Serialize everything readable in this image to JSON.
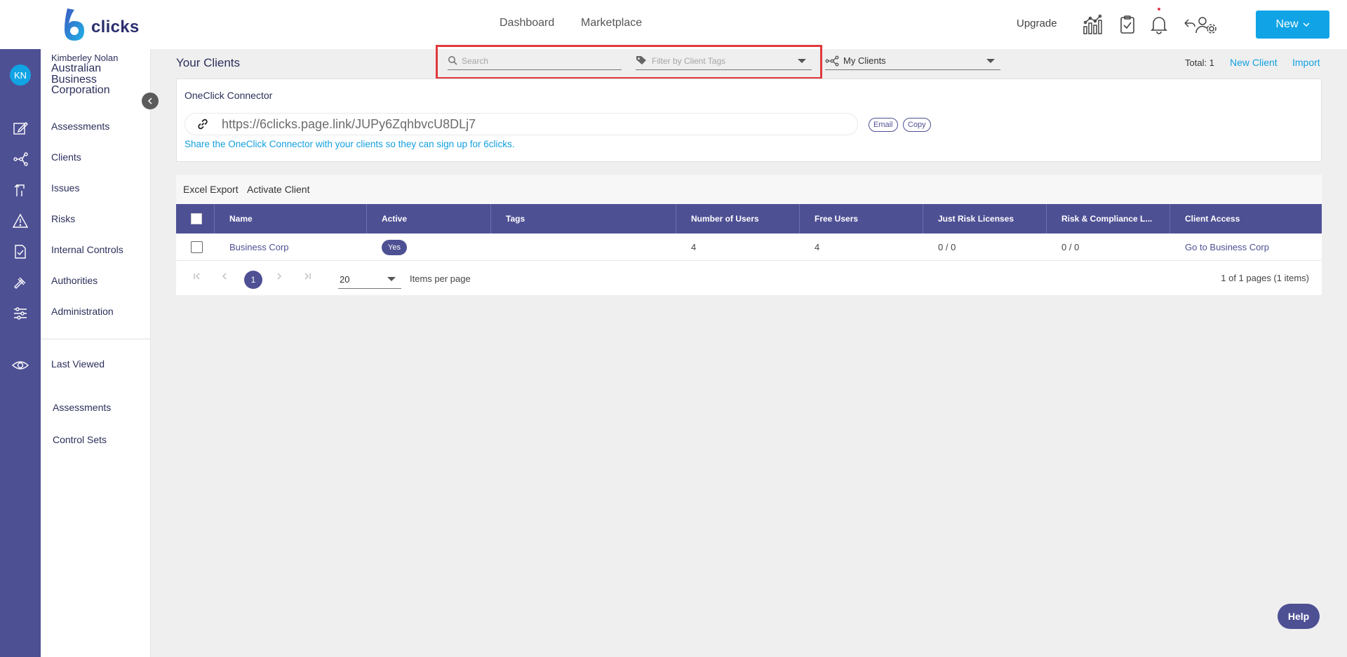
{
  "app": {
    "logo_text": "clicks",
    "logo_mark": "6"
  },
  "topnav": {
    "dashboard": "Dashboard",
    "marketplace": "Marketplace",
    "upgrade": "Upgrade",
    "new_button": "New"
  },
  "icons": {
    "analytics": "analytics-icon",
    "tasks": "clipboard-check-icon",
    "notifications": "bell-icon",
    "settings": "user-settings-icon"
  },
  "user": {
    "initials": "KN",
    "name": "Kimberley Nolan",
    "org": "Australian Business Corporation"
  },
  "sidebar": {
    "items": [
      {
        "label": "Assessments"
      },
      {
        "label": "Clients"
      },
      {
        "label": "Issues"
      },
      {
        "label": "Risks"
      },
      {
        "label": "Internal Controls"
      },
      {
        "label": "Authorities"
      },
      {
        "label": "Administration"
      }
    ],
    "last_viewed": "Last Viewed",
    "recent": [
      {
        "label": "Assessments"
      },
      {
        "label": "Control Sets"
      }
    ]
  },
  "page": {
    "title": "Your Clients",
    "search_placeholder": "Search",
    "tag_placeholder": "Filter by Client Tags",
    "scope_value": "My Clients",
    "total": "Total: 1",
    "new_client": "New Client",
    "import": "Import"
  },
  "connector": {
    "title": "OneClick Connector",
    "url": "https://6clicks.page.link/JUPy6ZqhbvcU8DLj7",
    "email": "Email",
    "copy": "Copy",
    "help": "Share the OneClick Connector with your clients so they can sign up for 6clicks."
  },
  "table": {
    "actions": {
      "export": "Excel Export",
      "activate": "Activate Client"
    },
    "columns": [
      "Name",
      "Active",
      "Tags",
      "Number of Users",
      "Free Users",
      "Just Risk Licenses",
      "Risk & Compliance L...",
      "Client Access"
    ],
    "rows": [
      {
        "name": "Business Corp",
        "active": "Yes",
        "tags": "",
        "users": "4",
        "free_users": "4",
        "just_risk": "0 / 0",
        "risk_compliance": "0 / 0",
        "access": "Go to Business Corp"
      }
    ],
    "pager": {
      "current_page": "1",
      "per_page": "20",
      "per_page_label": "Items per page",
      "info": "1 of 1 pages (1 items)"
    }
  },
  "help_button": "Help"
}
